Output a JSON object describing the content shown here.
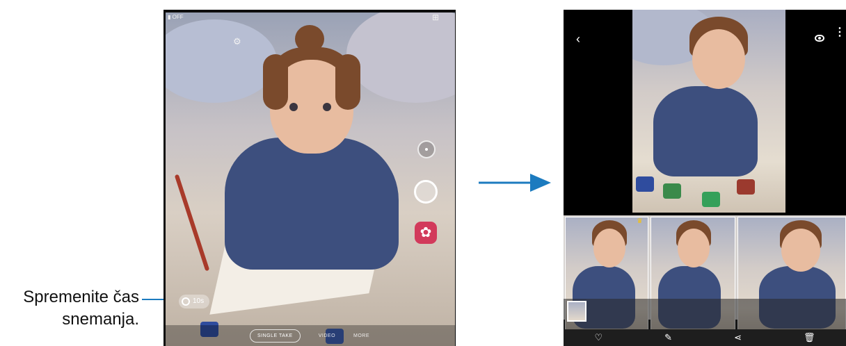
{
  "callout": {
    "line1": "Spremenite čas",
    "line2": "snemanja."
  },
  "camera": {
    "mode_label": "SINGLE TAKE",
    "timer_label": "10s",
    "other_modes": [
      "VIDEO",
      "MORE"
    ],
    "flash_label": "OFF"
  },
  "gallery": {
    "back_icon": "chevron-left-icon",
    "view_icon": "eye-icon",
    "more_icon": "more-vert-icon",
    "toolbar": [
      "heart-icon",
      "edit-icon",
      "share-icon",
      "delete-icon"
    ]
  },
  "colors": {
    "accent_blue": "#1c7bbf",
    "single_take_red": "#d23a5b",
    "crown_yellow": "#f3c21b"
  }
}
